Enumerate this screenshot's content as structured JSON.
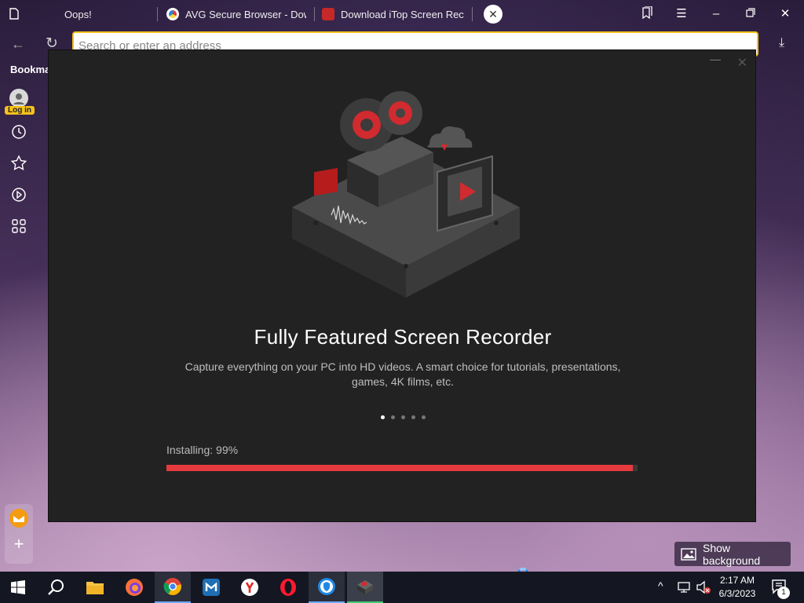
{
  "browser": {
    "tabs": [
      {
        "label": "Oops!"
      },
      {
        "label": "AVG Secure Browser - Dow"
      },
      {
        "label": "Download iTop Screen Rec"
      }
    ],
    "address_placeholder": "Search or enter an address",
    "bookmarks_label": "Bookma",
    "login_label": "Log in",
    "show_background_label": "Show background"
  },
  "installer": {
    "title": "Fully Featured Screen Recorder",
    "description": "Capture everything on your PC into HD videos. A smart choice for tutorials, presentations, games, 4K films, etc.",
    "slides_total": 5,
    "slide_active": 1,
    "progress_label": "Installing: 99%",
    "progress_value": 0.99,
    "accent_color": "#e63a3f"
  },
  "taskbar": {
    "apps": [
      "windows-start",
      "search",
      "file-explorer",
      "firefox",
      "chrome",
      "maxthon",
      "yandex",
      "opera",
      "avg-secure-browser",
      "itop-installer"
    ],
    "time": "2:17 AM",
    "date": "6/3/2023",
    "notification_count": "1"
  }
}
